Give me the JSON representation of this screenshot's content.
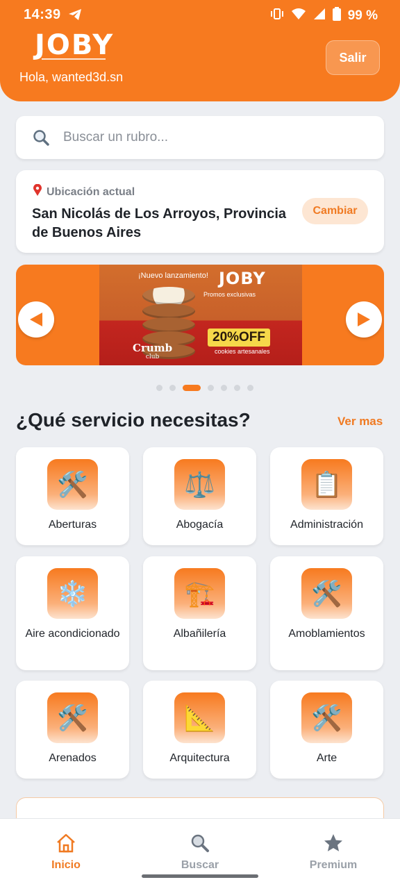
{
  "status_bar": {
    "time": "14:39",
    "battery": "99 %"
  },
  "header": {
    "logo": "JOBY",
    "greeting": "Hola, wanted3d.sn",
    "logout_label": "Salir"
  },
  "search": {
    "placeholder": "Buscar un rubro..."
  },
  "location": {
    "label": "Ubicación actual",
    "value": "San Nicolás de Los Arroyos, Provincia de Buenos Aires",
    "change_label": "Cambiar"
  },
  "banner": {
    "launch": "¡Nuevo lanzamiento!",
    "logo": "JOBY",
    "promo": "Promos exclusivas",
    "discount": "20%OFF",
    "product": "cookies artesanales",
    "brand": "Crumb",
    "brand_sub": "club",
    "active_slide": 3,
    "slide_count": 7
  },
  "services": {
    "title": "¿Qué servicio necesitas?",
    "see_more": "Ver mas",
    "items": [
      {
        "label": "Aberturas",
        "icon": "🛠️",
        "icon_name": "tools-icon"
      },
      {
        "label": "Abogacía",
        "icon": "⚖️",
        "icon_name": "scales-icon"
      },
      {
        "label": "Administración",
        "icon": "📋",
        "icon_name": "clipboard-icon"
      },
      {
        "label": "Aire acondicionado",
        "icon": "❄️",
        "icon_name": "snowflake-icon"
      },
      {
        "label": "Albañilería",
        "icon": "🏗️",
        "icon_name": "construction-crane-icon"
      },
      {
        "label": "Amoblamientos",
        "icon": "🛠️",
        "icon_name": "tools-icon"
      },
      {
        "label": "Arenados",
        "icon": "🛠️",
        "icon_name": "tools-icon"
      },
      {
        "label": "Arquitectura",
        "icon": "📐",
        "icon_name": "triangle-ruler-icon"
      },
      {
        "label": "Arte",
        "icon": "🛠️",
        "icon_name": "tools-icon"
      }
    ]
  },
  "nav": {
    "home": "Inicio",
    "search": "Buscar",
    "premium": "Premium"
  },
  "colors": {
    "accent": "#f77a1f",
    "background": "#eceef2",
    "inactive": "#9aa0a8"
  }
}
